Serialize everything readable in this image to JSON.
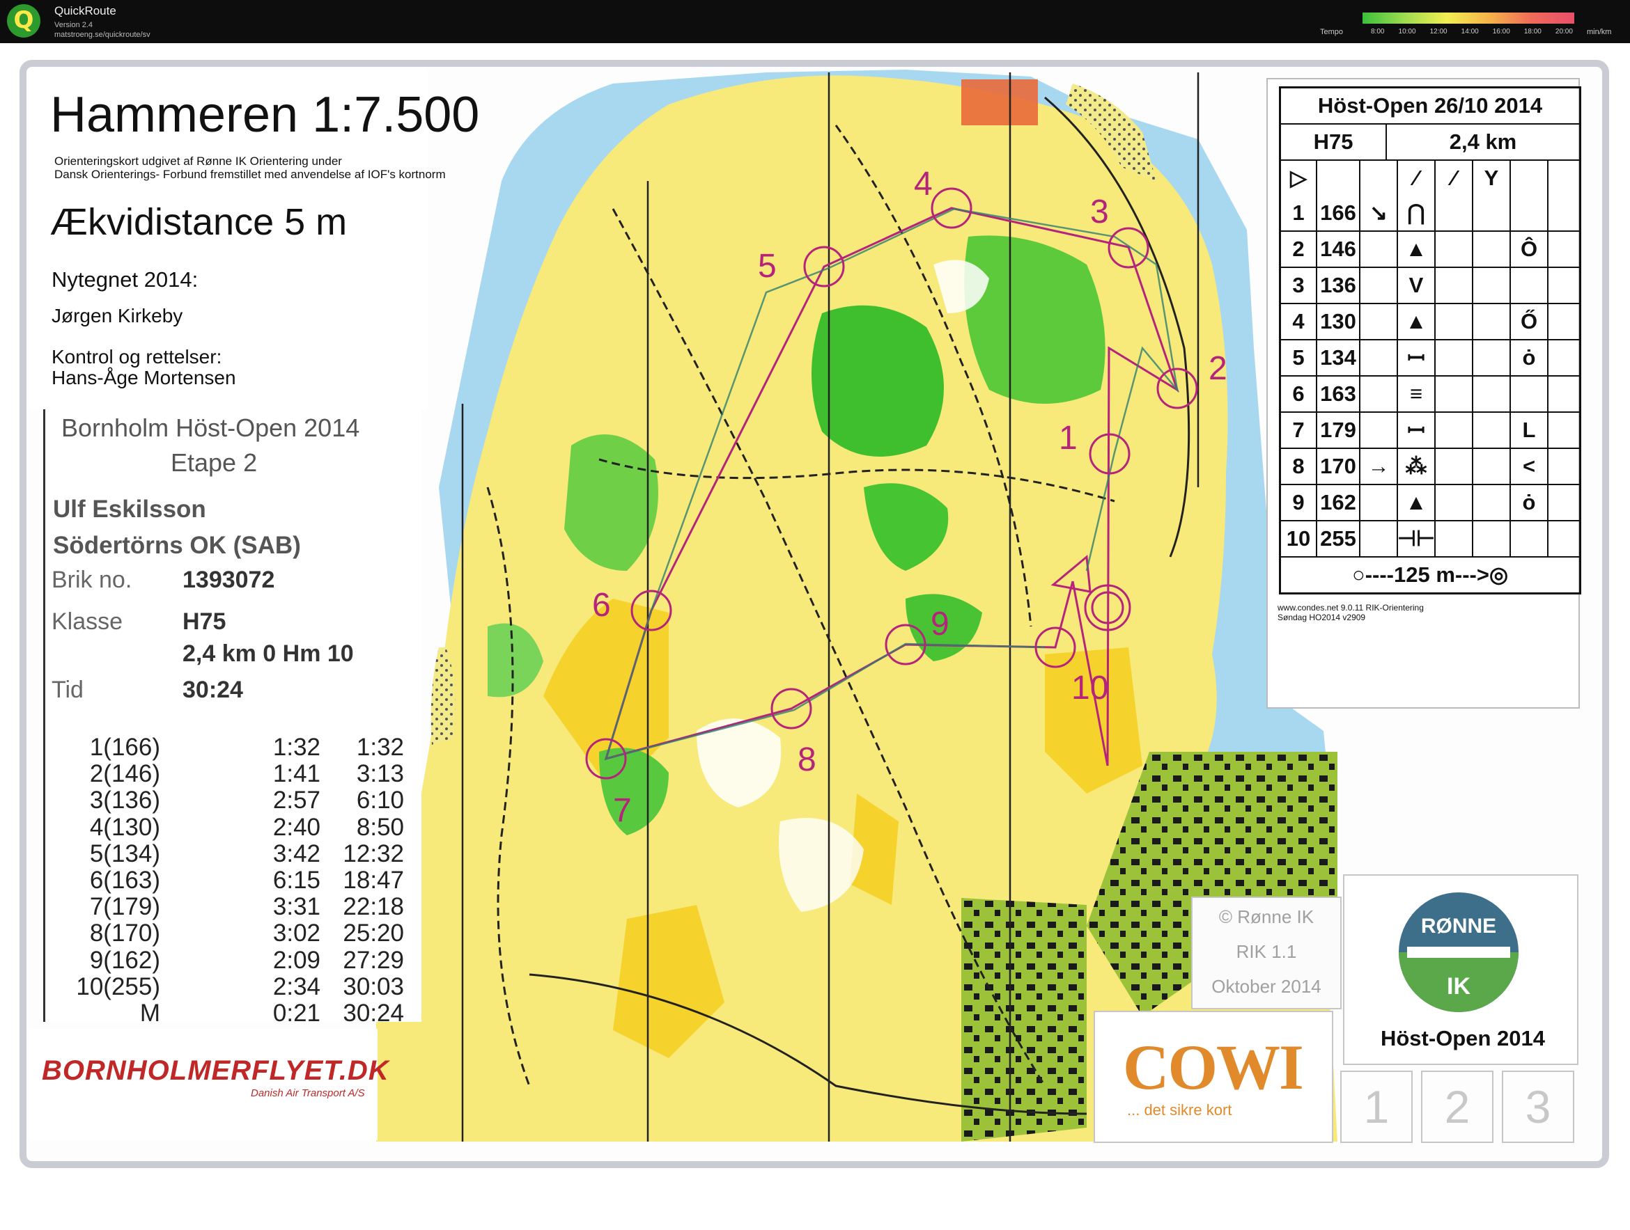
{
  "app": {
    "name": "QuickRoute",
    "version": "Version 2.4",
    "url": "matstroeng.se/quickroute/sv",
    "tempo_label": "Tempo",
    "tempo_ticks": [
      "8:00",
      "10:00",
      "12:00",
      "14:00",
      "16:00",
      "18:00",
      "20:00"
    ],
    "tempo_unit": "min/km"
  },
  "map": {
    "title": "Hammeren 1:7.500",
    "subtitle_line1": "Orienteringskort udgivet af Rønne IK Orientering under",
    "subtitle_line2": "Dansk Orienterings- Forbund fremstillet med anvendelse af IOF's kortnorm",
    "equidistance": "Ækvidistance 5 m",
    "redrawn_label": "Nytegnet 2014:",
    "redrawn_by": "Jørgen Kirkeby",
    "control_label": "Kontrol og rettelser:",
    "control_by": "Hans-Åge Mortensen",
    "control_numbers": [
      "1",
      "2",
      "3",
      "4",
      "5",
      "6",
      "7",
      "8",
      "9",
      "10"
    ]
  },
  "result": {
    "event": "Bornholm Höst-Open 2014",
    "stage": "Etape 2",
    "name": "Ulf Eskilsson",
    "club": "Södertörns OK (SAB)",
    "brik_label": "Brik no.",
    "brik_value": "1393072",
    "class_label": "Klasse",
    "class_value": "H75",
    "course_info": "2,4 km  0 Hm 10",
    "time_label": "Tid",
    "time_value": "30:24",
    "splits": [
      {
        "control": "1(166)",
        "split": "1:32",
        "cumulative": "1:32"
      },
      {
        "control": "2(146)",
        "split": "1:41",
        "cumulative": "3:13"
      },
      {
        "control": "3(136)",
        "split": "2:57",
        "cumulative": "6:10"
      },
      {
        "control": "4(130)",
        "split": "2:40",
        "cumulative": "8:50"
      },
      {
        "control": "5(134)",
        "split": "3:42",
        "cumulative": "12:32"
      },
      {
        "control": "6(163)",
        "split": "6:15",
        "cumulative": "18:47"
      },
      {
        "control": "7(179)",
        "split": "3:31",
        "cumulative": "22:18"
      },
      {
        "control": "8(170)",
        "split": "3:02",
        "cumulative": "25:20"
      },
      {
        "control": "9(162)",
        "split": "2:09",
        "cumulative": "27:29"
      },
      {
        "control": "10(255)",
        "split": "2:34",
        "cumulative": "30:03"
      },
      {
        "control": "M",
        "split": "0:21",
        "cumulative": "30:24"
      }
    ]
  },
  "sponsor": {
    "bornholmer": "BORNHOLMERFLYET.DK",
    "bornholmer_sub": "Danish Air Transport A/S",
    "cowi": "COWI",
    "cowi_sub": "... det sikre kort",
    "credit_line1": "© Rønne IK",
    "credit_line2": "RIK 1.1",
    "credit_line3": "Oktober 2014",
    "club_logo_top": "RØNNE",
    "club_logo_bottom": "IK",
    "club_event": "Höst-Open 2014",
    "box_numbers": [
      "1",
      "2",
      "3"
    ]
  },
  "description": {
    "event": "Höst-Open 26/10 2014",
    "class": "H75",
    "length": "2,4 km",
    "finish": "○----125 m--->◎",
    "footer_line1": "www.condes.net 9.0.11 RIK-Orientering",
    "footer_line2": "Søndag HO2014 v2909",
    "rows": [
      {
        "num": "1",
        "code": "166",
        "col_d": "↘",
        "col_e": "⋂"
      },
      {
        "num": "2",
        "code": "146",
        "col_d": "",
        "col_e": "▲",
        "col_h": "Ô"
      },
      {
        "num": "3",
        "code": "136",
        "col_d": "",
        "col_e": "V"
      },
      {
        "num": "4",
        "code": "130",
        "col_d": "",
        "col_e": "▲",
        "col_h": "Ő"
      },
      {
        "num": "5",
        "code": "134",
        "col_d": "",
        "col_e": "ꟷ",
        "col_h": "ȯ"
      },
      {
        "num": "6",
        "code": "163",
        "col_d": "",
        "col_e": "≡"
      },
      {
        "num": "7",
        "code": "179",
        "col_d": "",
        "col_e": "ꟷ",
        "col_h": "L"
      },
      {
        "num": "8",
        "code": "170",
        "col_d": "→",
        "col_e": "⁂",
        "col_h": "<"
      },
      {
        "num": "9",
        "code": "162",
        "col_d": "",
        "col_e": "▲",
        "col_h": "ȯ"
      },
      {
        "num": "10",
        "code": "255",
        "col_d": "",
        "col_e": "⊣⊢"
      }
    ]
  }
}
